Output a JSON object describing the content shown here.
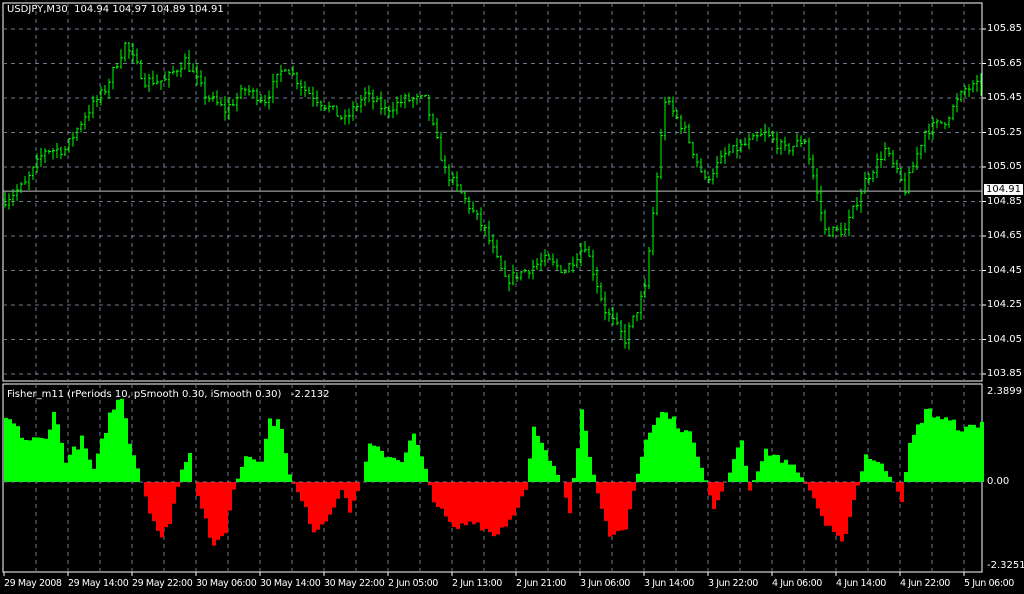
{
  "header": {
    "symbol": "USDJPY,M30",
    "open": "104.94",
    "high": "104.97",
    "low": "104.89",
    "close": "104.91"
  },
  "indicator": {
    "title": "Fisher_m11  (rPeriods 10, pSmooth 0.30, iSmooth 0.30)",
    "value": "-2.2132",
    "max_label": "2.3899",
    "zero_label": "0.00",
    "min_label": "-2.3251"
  },
  "current_price": "104.91",
  "colors": {
    "background": "#000000",
    "bars": "#00ff00",
    "positive": "#00ff00",
    "negative": "#ff0000",
    "grid": "#6c7a8a",
    "axis": "#ffffff"
  },
  "chart_data": [
    {
      "type": "ohlc",
      "ylim": [
        103.85,
        105.85
      ],
      "yticks": [
        "105.85",
        "105.65",
        "105.45",
        "105.25",
        "105.05",
        "104.85",
        "104.65",
        "104.45",
        "104.25",
        "104.05",
        "103.85"
      ],
      "grid": true,
      "close_keypoints": [
        [
          0,
          104.86
        ],
        [
          5,
          104.95
        ],
        [
          10,
          105.15
        ],
        [
          15,
          105.15
        ],
        [
          20,
          105.35
        ],
        [
          25,
          105.5
        ],
        [
          30,
          105.76
        ],
        [
          35,
          105.55
        ],
        [
          40,
          105.55
        ],
        [
          45,
          105.67
        ],
        [
          50,
          105.47
        ],
        [
          55,
          105.38
        ],
        [
          60,
          105.5
        ],
        [
          65,
          105.44
        ],
        [
          70,
          105.64
        ],
        [
          75,
          105.5
        ],
        [
          80,
          105.41
        ],
        [
          85,
          105.32
        ],
        [
          90,
          105.47
        ],
        [
          95,
          105.38
        ],
        [
          100,
          105.44
        ],
        [
          105,
          105.44
        ],
        [
          110,
          105.03
        ],
        [
          115,
          104.86
        ],
        [
          120,
          104.68
        ],
        [
          125,
          104.39
        ],
        [
          130,
          104.45
        ],
        [
          135,
          104.51
        ],
        [
          140,
          104.45
        ],
        [
          145,
          104.6
        ],
        [
          150,
          104.22
        ],
        [
          155,
          104.05
        ],
        [
          160,
          104.34
        ],
        [
          165,
          105.44
        ],
        [
          170,
          105.26
        ],
        [
          175,
          104.97
        ],
        [
          180,
          105.12
        ],
        [
          185,
          105.18
        ],
        [
          190,
          105.24
        ],
        [
          195,
          105.15
        ],
        [
          200,
          105.21
        ],
        [
          205,
          104.68
        ],
        [
          210,
          104.68
        ],
        [
          215,
          104.97
        ],
        [
          220,
          105.15
        ],
        [
          225,
          104.92
        ],
        [
          230,
          105.26
        ],
        [
          235,
          105.32
        ],
        [
          240,
          105.5
        ],
        [
          245,
          105.53
        ]
      ]
    },
    {
      "type": "bar",
      "ylim": [
        -2.3251,
        2.3899
      ],
      "keypoints": [
        [
          1,
          1.65
        ],
        [
          5,
          1.12
        ],
        [
          10,
          1.12
        ],
        [
          12,
          1.91
        ],
        [
          15,
          0.58
        ],
        [
          19,
          1.12
        ],
        [
          22,
          0.32
        ],
        [
          26,
          1.78
        ],
        [
          29,
          2.31
        ],
        [
          31,
          1.12
        ],
        [
          34,
          0
        ],
        [
          36,
          -0.78
        ],
        [
          39,
          -1.61
        ],
        [
          41,
          -1.05
        ],
        [
          44,
          0.32
        ],
        [
          46,
          0.85
        ],
        [
          47,
          0
        ],
        [
          50,
          -1.05
        ],
        [
          52,
          -1.88
        ],
        [
          55,
          -1.33
        ],
        [
          57,
          -0.22
        ],
        [
          60,
          0.72
        ],
        [
          64,
          0.58
        ],
        [
          66,
          1.65
        ],
        [
          69,
          1.51
        ],
        [
          71,
          0.19
        ],
        [
          75,
          -0.78
        ],
        [
          77,
          -1.33
        ],
        [
          80,
          -1.05
        ],
        [
          84,
          -0.22
        ],
        [
          86,
          -0.78
        ],
        [
          89,
          0
        ],
        [
          91,
          0.98
        ],
        [
          95,
          0.72
        ],
        [
          99,
          0.58
        ],
        [
          102,
          1.25
        ],
        [
          105,
          0.32
        ],
        [
          107,
          -0.5
        ],
        [
          112,
          -1.33
        ],
        [
          117,
          -1.05
        ],
        [
          122,
          -1.47
        ],
        [
          126,
          -1.05
        ],
        [
          130,
          -0.22
        ],
        [
          132,
          1.38
        ],
        [
          136,
          0.58
        ],
        [
          139,
          0
        ],
        [
          141,
          -0.78
        ],
        [
          144,
          1.91
        ],
        [
          146,
          0.72
        ],
        [
          149,
          -0.78
        ],
        [
          151,
          -1.61
        ],
        [
          155,
          -1.33
        ],
        [
          157,
          -0.22
        ],
        [
          160,
          1.12
        ],
        [
          164,
          1.86
        ],
        [
          167,
          1.65
        ],
        [
          172,
          1.12
        ],
        [
          175,
          0.05
        ],
        [
          177,
          -0.78
        ],
        [
          180,
          0
        ],
        [
          184,
          1.12
        ],
        [
          186,
          -0.22
        ],
        [
          190,
          0.85
        ],
        [
          194,
          0.58
        ],
        [
          197,
          0.45
        ],
        [
          201,
          -0.22
        ],
        [
          205,
          -1.19
        ],
        [
          209,
          -1.74
        ],
        [
          212,
          -0.5
        ],
        [
          215,
          0.72
        ],
        [
          219,
          0.45
        ],
        [
          222,
          0
        ],
        [
          224,
          -0.5
        ],
        [
          226,
          0.98
        ],
        [
          230,
          1.91
        ],
        [
          235,
          1.65
        ],
        [
          240,
          1.38
        ],
        [
          245,
          1.65
        ]
      ]
    }
  ],
  "time_labels": [
    "29 May 2008",
    "29 May 14:00",
    "29 May 22:00",
    "30 May 06:00",
    "30 May 14:00",
    "30 May 22:00",
    "2 Jun 05:00",
    "2 Jun 13:00",
    "2 Jun 21:00",
    "3 Jun 06:00",
    "3 Jun 14:00",
    "3 Jun 22:00",
    "4 Jun 06:00",
    "4 Jun 14:00",
    "4 Jun 22:00",
    "5 Jun 06:00"
  ]
}
